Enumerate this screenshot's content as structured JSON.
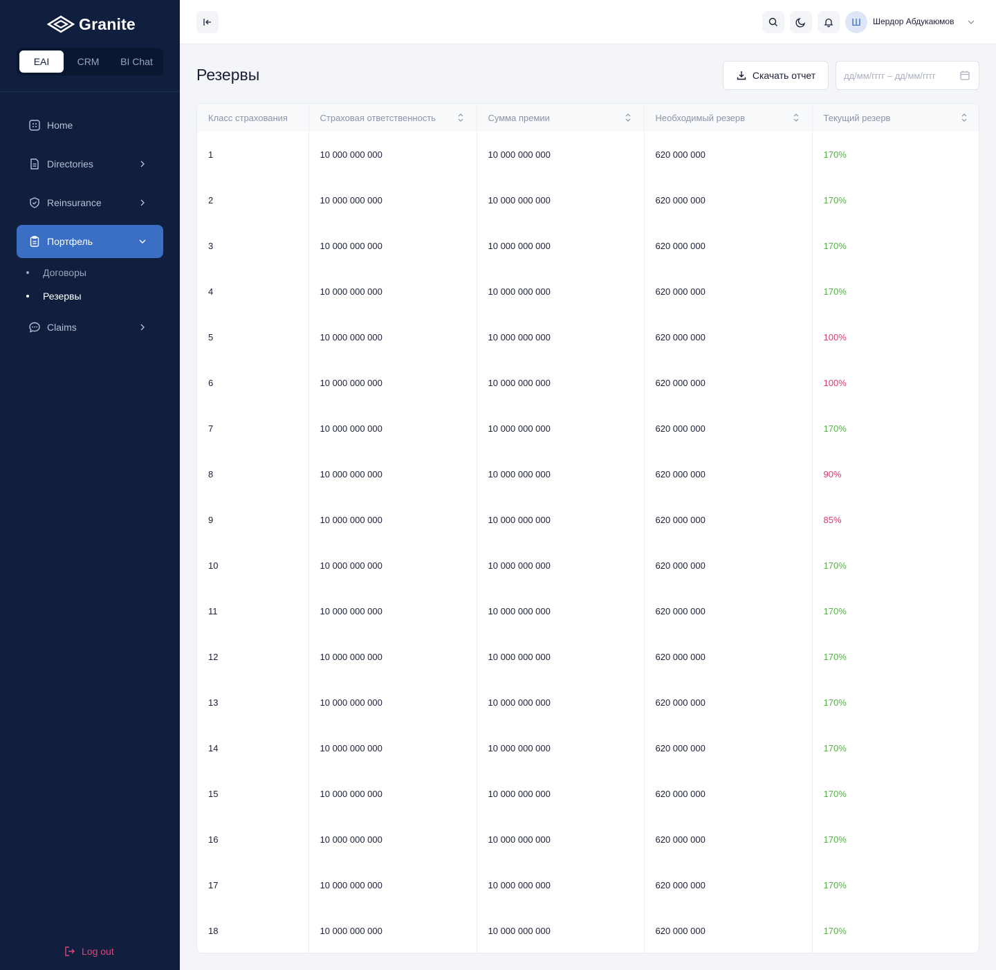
{
  "brand": {
    "name": "Granite"
  },
  "switcher": {
    "items": [
      "EAI",
      "CRM",
      "BI Chat"
    ],
    "active": "EAI"
  },
  "sidebar": {
    "items": [
      {
        "label": "Home",
        "icon": "home-grid-icon"
      },
      {
        "label": "Directories",
        "icon": "document-icon"
      },
      {
        "label": "Reinsurance",
        "icon": "shield-icon"
      },
      {
        "label": "Портфель",
        "icon": "clipboard-icon"
      },
      {
        "label": "Claims",
        "icon": "chat-icon"
      }
    ],
    "sub_items": [
      {
        "label": "Договоры"
      },
      {
        "label": "Резервы"
      }
    ],
    "logout": "Log out"
  },
  "topbar": {
    "username": "Шердор Абдукаюмов",
    "avatar_initial": "Ш"
  },
  "page": {
    "title": "Резервы",
    "download_label": "Скачать отчет",
    "date_placeholder": "дд/мм/гггг – дд/мм/гггг"
  },
  "table": {
    "columns": [
      "Класс страхования",
      "Страховая ответственность",
      "Сумма премии",
      "Необходимый резерв",
      "Текущий резерв"
    ],
    "rows": [
      {
        "class": "1",
        "liability": "10 000 000 000",
        "premium": "10 000 000 000",
        "required": "620 000 000",
        "current": "170%",
        "status": "green"
      },
      {
        "class": "2",
        "liability": "10 000 000 000",
        "premium": "10 000 000 000",
        "required": "620 000 000",
        "current": "170%",
        "status": "green"
      },
      {
        "class": "3",
        "liability": "10 000 000 000",
        "premium": "10 000 000 000",
        "required": "620 000 000",
        "current": "170%",
        "status": "green"
      },
      {
        "class": "4",
        "liability": "10 000 000 000",
        "premium": "10 000 000 000",
        "required": "620 000 000",
        "current": "170%",
        "status": "green"
      },
      {
        "class": "5",
        "liability": "10 000 000 000",
        "premium": "10 000 000 000",
        "required": "620 000 000",
        "current": "100%",
        "status": "red"
      },
      {
        "class": "6",
        "liability": "10 000 000 000",
        "premium": "10 000 000 000",
        "required": "620 000 000",
        "current": "100%",
        "status": "red"
      },
      {
        "class": "7",
        "liability": "10 000 000 000",
        "premium": "10 000 000 000",
        "required": "620 000 000",
        "current": "170%",
        "status": "green"
      },
      {
        "class": "8",
        "liability": "10 000 000 000",
        "premium": "10 000 000 000",
        "required": "620 000 000",
        "current": "90%",
        "status": "red"
      },
      {
        "class": "9",
        "liability": "10 000 000 000",
        "premium": "10 000 000 000",
        "required": "620 000 000",
        "current": "85%",
        "status": "red"
      },
      {
        "class": "10",
        "liability": "10 000 000 000",
        "premium": "10 000 000 000",
        "required": "620 000 000",
        "current": "170%",
        "status": "green"
      },
      {
        "class": "11",
        "liability": "10 000 000 000",
        "premium": "10 000 000 000",
        "required": "620 000 000",
        "current": "170%",
        "status": "green"
      },
      {
        "class": "12",
        "liability": "10 000 000 000",
        "premium": "10 000 000 000",
        "required": "620 000 000",
        "current": "170%",
        "status": "green"
      },
      {
        "class": "13",
        "liability": "10 000 000 000",
        "premium": "10 000 000 000",
        "required": "620 000 000",
        "current": "170%",
        "status": "green"
      },
      {
        "class": "14",
        "liability": "10 000 000 000",
        "premium": "10 000 000 000",
        "required": "620 000 000",
        "current": "170%",
        "status": "green"
      },
      {
        "class": "15",
        "liability": "10 000 000 000",
        "premium": "10 000 000 000",
        "required": "620 000 000",
        "current": "170%",
        "status": "green"
      },
      {
        "class": "16",
        "liability": "10 000 000 000",
        "premium": "10 000 000 000",
        "required": "620 000 000",
        "current": "170%",
        "status": "green"
      },
      {
        "class": "17",
        "liability": "10 000 000 000",
        "premium": "10 000 000 000",
        "required": "620 000 000",
        "current": "170%",
        "status": "green"
      },
      {
        "class": "18",
        "liability": "10 000 000 000",
        "premium": "10 000 000 000",
        "required": "620 000 000",
        "current": "170%",
        "status": "green"
      }
    ]
  },
  "colors": {
    "sidebar_bg": "#0f1f3d",
    "accent": "#3b6fc4",
    "ok": "#52b043",
    "bad": "#d9386f",
    "logout": "#e0457b"
  }
}
